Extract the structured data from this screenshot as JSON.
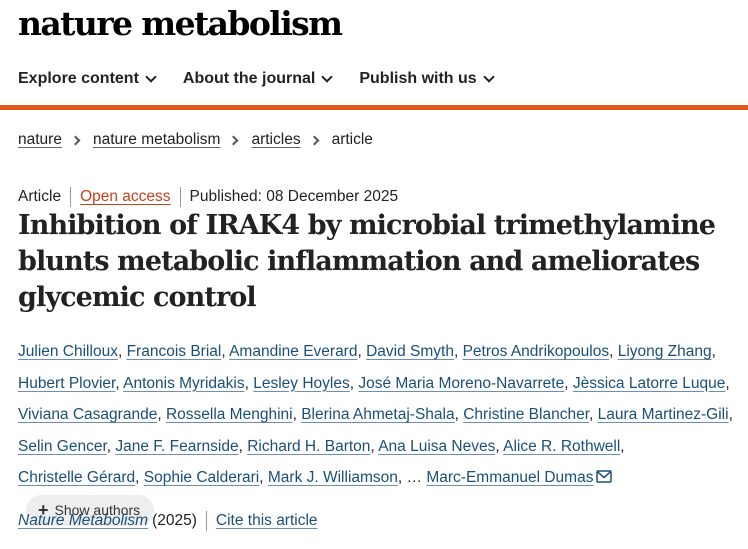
{
  "site": {
    "logo_text": "nature metabolism"
  },
  "nav": {
    "items": [
      {
        "label": "Explore content"
      },
      {
        "label": "About the journal"
      },
      {
        "label": "Publish with us"
      }
    ]
  },
  "breadcrumb": {
    "items": [
      "nature",
      "nature metabolism",
      "articles"
    ],
    "current": "article"
  },
  "article_meta": {
    "type": "Article",
    "access": "Open access",
    "published": "Published: 08 December 2025"
  },
  "title": "Inhibition of IRAK4 by microbial trimethylamine blunts metabolic inflammation and ameliorates glycemic control",
  "authors": [
    "Julien Chilloux",
    "Francois Brial",
    "Amandine Everard",
    "David Smyth",
    "Petros Andrikopoulos",
    "Liyong Zhang",
    "Hubert Plovier",
    "Antonis Myridakis",
    "Lesley Hoyles",
    "José Maria Moreno-Navarrete",
    "Jèssica Latorre Luque",
    "Viviana Casagrande",
    "Rossella Menghini",
    "Blerina Ahmetaj-Shala",
    "Christine Blancher",
    "Laura Martinez-Gili",
    "Selin Gencer",
    "Jane F. Fearnside",
    "Richard H. Barton",
    "Ana Luisa Neves",
    "Alice R. Rothwell",
    "Christelle Gérard",
    "Sophie Calderari",
    "Mark J. Williamson"
  ],
  "ellipsis": "…",
  "last_author": "Marc-Emmanuel Dumas",
  "show_authors_label": "Show authors",
  "citation": {
    "journal": "Nature Metabolism",
    "year": "(2025)",
    "cite_label": "Cite this article"
  }
}
